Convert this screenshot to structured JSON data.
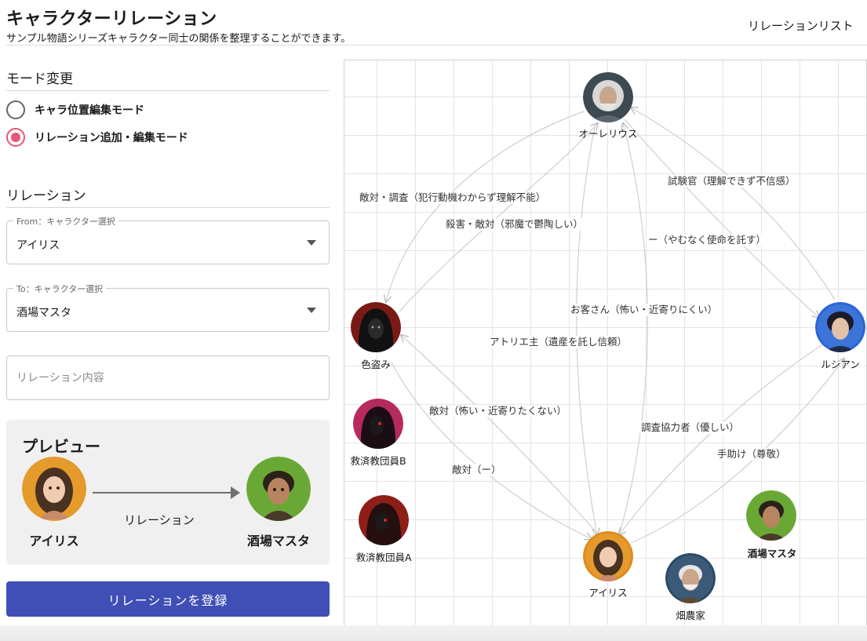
{
  "header": {
    "title": "キャラクターリレーション",
    "subtitle": "サンプル物語シリーズキャラクター同士の関係を整理することができます。",
    "nav_link": "リレーションリスト"
  },
  "mode": {
    "title": "モード変更",
    "options": [
      {
        "label": "キャラ位置編集モード",
        "selected": false
      },
      {
        "label": "リレーション追加・編集モード",
        "selected": true
      }
    ]
  },
  "relation": {
    "title": "リレーション",
    "from_label": "From：キャラクター選択",
    "from_value": "アイリス",
    "to_label": "To：キャラクター選択",
    "to_value": "酒場マスタ",
    "content_placeholder": "リレーション内容"
  },
  "preview": {
    "title": "プレビュー",
    "from_name": "アイリス",
    "to_name": "酒場マスタ",
    "relation_text": "リレーション"
  },
  "submit_label": "リレーションを登録",
  "graph": {
    "nodes": [
      {
        "id": "aurelius",
        "name": "オーレリウス",
        "ring": "#555555",
        "skin": "#c9a58a",
        "hair": "#d8d8d8",
        "bg": "#3d4a52"
      },
      {
        "id": "iro",
        "name": "色盗み",
        "ring": "#8e1c14",
        "skin": "#2a2a2a",
        "hair": "#111111",
        "bg": "#7a1a14"
      },
      {
        "id": "lucian",
        "name": "ルシアン",
        "ring": "#2c64d8",
        "skin": "#e2c3a8",
        "hair": "#1b1b2a",
        "bg": "#3c74d8"
      },
      {
        "id": "kyusaiB",
        "name": "救済教団員B",
        "ring": "#d1356e",
        "skin": "#1a1a1a",
        "hair": "#2a0f1a",
        "bg": "#b72a5e"
      },
      {
        "id": "kyusaiA",
        "name": "救済教団員A",
        "ring": "#a7241c",
        "skin": "#1a1a1a",
        "hair": "#2a0e0e",
        "bg": "#8e1f18"
      },
      {
        "id": "sakaba",
        "name": "酒場マスタ",
        "ring": "#5a9a2c",
        "skin": "#b98460",
        "hair": "#2a2118",
        "bg": "#6aa836"
      },
      {
        "id": "iris",
        "name": "アイリス",
        "ring": "#e08a1e",
        "skin": "#f0cdb0",
        "hair": "#4a3222",
        "bg": "#e59a2c"
      },
      {
        "id": "hatake",
        "name": "畑農家",
        "ring": "#2a4a66",
        "skin": "#c9a58a",
        "hair": "#e6e6e6",
        "bg": "#3b5a78"
      }
    ],
    "edge_labels": [
      "敵対・調査（犯行動機わからず理解不能）",
      "殺害・敵対（邪魔で鬱陶しい）",
      "試験官（理解できず不信感）",
      "ー（やむなく使命を託す）",
      "お客さん（怖い・近寄りにくい）",
      "アトリエ主（遺産を託し信頼）",
      "敵対（怖い・近寄りたくない）",
      "調査協力者（優しい）",
      "手助け（尊敬）",
      "敵対（ー）"
    ]
  }
}
